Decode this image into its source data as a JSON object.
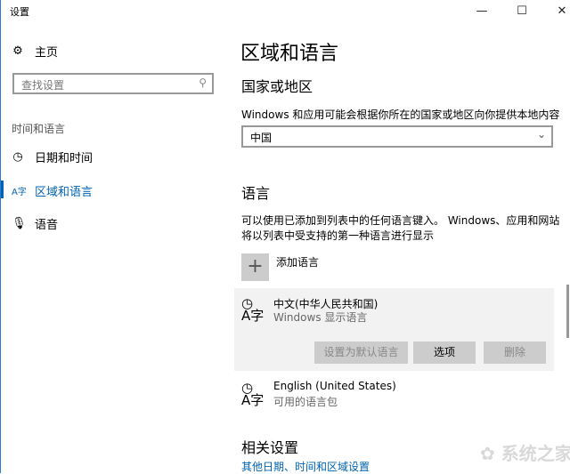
{
  "window": {
    "title": "设置",
    "minimize": "—",
    "maximize": "☐",
    "close": "✕"
  },
  "sidebar": {
    "home": "主页",
    "search_placeholder": "查找设置",
    "section": "时间和语言",
    "items": [
      {
        "label": "日期和时间"
      },
      {
        "label": "区域和语言"
      },
      {
        "label": "语音"
      }
    ]
  },
  "main": {
    "title": "区域和语言",
    "country_heading": "国家或地区",
    "country_desc": "Windows 和应用可能会根据你所在的国家或地区向你提供本地内容",
    "country_value": "中国",
    "lang_heading": "语言",
    "lang_desc1": "可以使用已添加到列表中的任何语言键入。 Windows、应用和网站",
    "lang_desc2": "将以列表中受支持的第一种语言进行显示",
    "add_language": "添加语言",
    "languages": [
      {
        "name": "中文(中华人民共和国)",
        "status": "Windows 显示语言"
      },
      {
        "name": "English (United States)",
        "status": "可用的语言包"
      }
    ],
    "buttons": {
      "set_default": "设置为默认语言",
      "options": "选项",
      "remove": "删除"
    },
    "related_heading": "相关设置",
    "related_link": "其他日期、时间和区域设置"
  },
  "watermark": "系统之家",
  "colors": {
    "accent": "#0063b1",
    "selected_bg": "#f2f2f2"
  }
}
